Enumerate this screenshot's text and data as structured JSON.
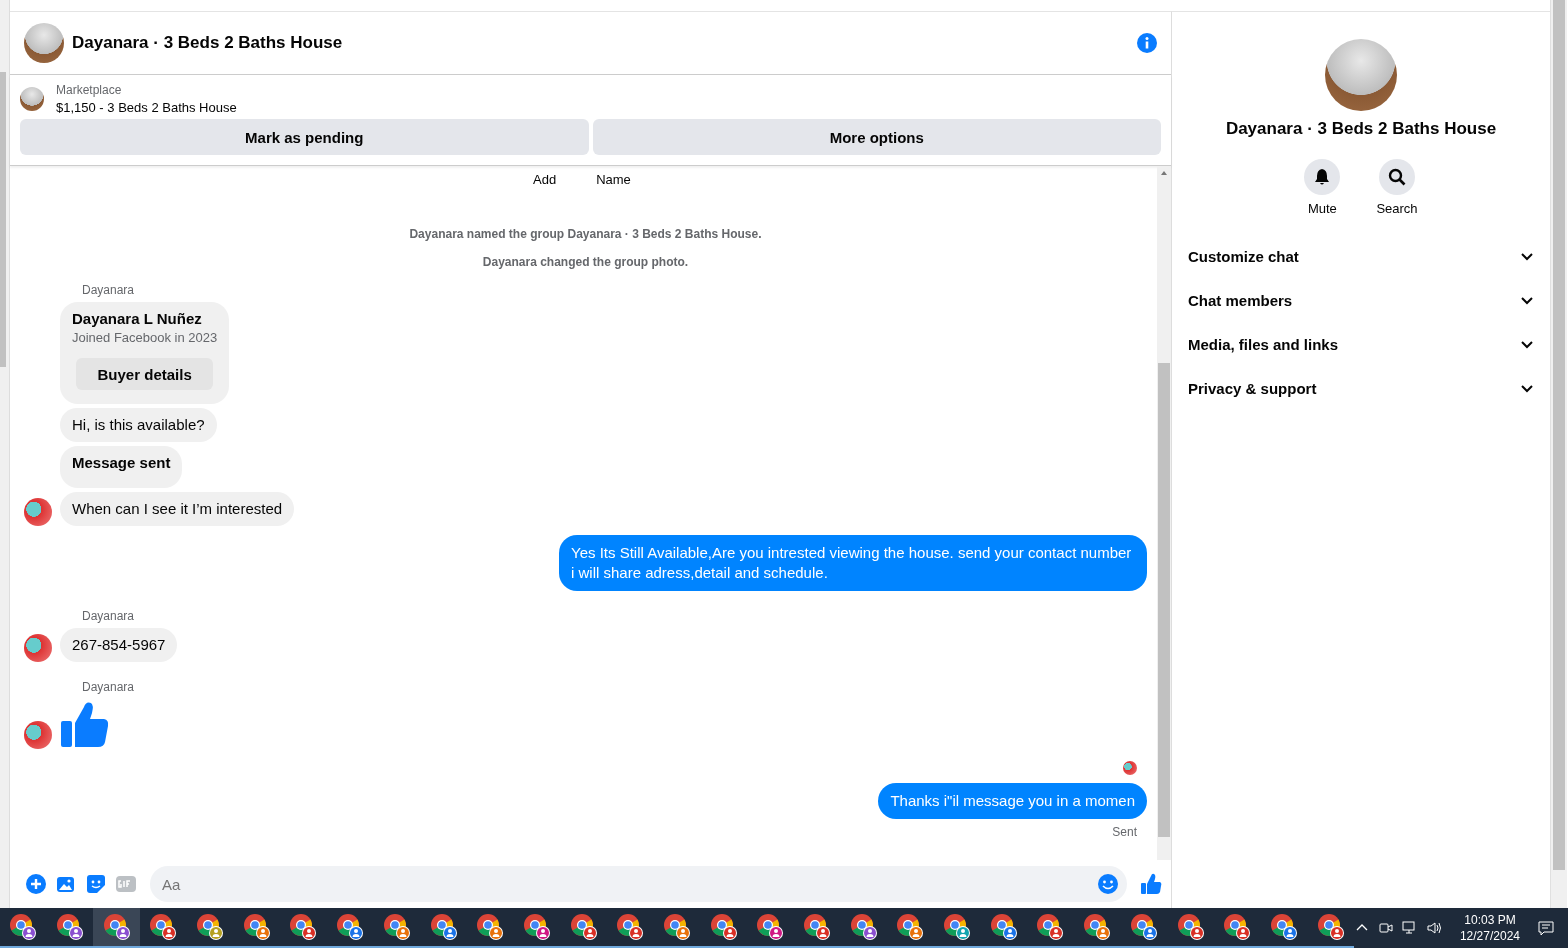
{
  "chat": {
    "title": "Dayanara · 3 Beds 2 Baths House",
    "listing": {
      "source": "Marketplace",
      "title": "$1,150 - 3 Beds 2 Baths House"
    },
    "actions": [
      "Mark as pending",
      "More options"
    ],
    "clipped_row": [
      "Add",
      "Name"
    ],
    "messages": [
      {
        "kind": "system",
        "text": "Dayanara named the group Dayanara · 3 Beds 2 Baths House."
      },
      {
        "kind": "system",
        "text": "Dayanara changed the group photo."
      },
      {
        "kind": "sender",
        "text": "Dayanara"
      },
      {
        "kind": "card",
        "name": "Dayanara L Nuñez",
        "subtitle": "Joined Facebook in 2023",
        "button": "Buyer details"
      },
      {
        "kind": "incoming",
        "text": "Hi, is this available?",
        "avatar": false
      },
      {
        "kind": "notice",
        "text": "Message sent",
        "avatar": false
      },
      {
        "kind": "incoming",
        "text": "When can I see it I’m interested",
        "avatar": true
      },
      {
        "kind": "outgoing",
        "text": "Yes Its Still Available,Are you intrested viewing the house. send your contact number i will share adress,detail and schedule."
      },
      {
        "kind": "sender",
        "text": "Dayanara"
      },
      {
        "kind": "incoming",
        "text": "267-854-5967",
        "avatar": true
      },
      {
        "kind": "sender",
        "text": "Dayanara"
      },
      {
        "kind": "like",
        "avatar": true
      },
      {
        "kind": "seen"
      },
      {
        "kind": "outgoing",
        "text": "Thanks i\"il message you in a momen"
      },
      {
        "kind": "status",
        "text": "Sent"
      }
    ],
    "composer": {
      "placeholder": "Aa"
    }
  },
  "details": {
    "title": "Dayanara · 3 Beds 2 Baths House",
    "buttons": [
      {
        "kind": "mute",
        "label": "Mute"
      },
      {
        "kind": "search",
        "label": "Search"
      }
    ],
    "sections": [
      {
        "label": "Customize chat",
        "expanded": false
      },
      {
        "label": "Chat members",
        "expanded": false
      },
      {
        "label": "Media, files and links",
        "expanded": false
      },
      {
        "label": "Privacy & support",
        "expanded": false
      }
    ]
  },
  "taskbar": {
    "apps": [
      {
        "color": "#8a4fd0",
        "selected": false
      },
      {
        "color": "#8a4fd0",
        "selected": false
      },
      {
        "color": "#8a4fd0",
        "selected": true
      },
      {
        "color": "#d93025",
        "selected": false
      },
      {
        "color": "#b5a020",
        "selected": false
      },
      {
        "color": "#e8710a",
        "selected": false
      },
      {
        "color": "#d93025",
        "selected": false
      },
      {
        "color": "#1a73e8",
        "selected": false
      },
      {
        "color": "#e8710a",
        "selected": false
      },
      {
        "color": "#1a73e8",
        "selected": false
      },
      {
        "color": "#e8710a",
        "selected": false
      },
      {
        "color": "#d01884",
        "selected": false
      },
      {
        "color": "#d93025",
        "selected": false
      },
      {
        "color": "#d93025",
        "selected": false
      },
      {
        "color": "#e8710a",
        "selected": false
      },
      {
        "color": "#d93025",
        "selected": false
      },
      {
        "color": "#d01884",
        "selected": false
      },
      {
        "color": "#d93025",
        "selected": false
      },
      {
        "color": "#8a4fd0",
        "selected": false
      },
      {
        "color": "#e8710a",
        "selected": false
      },
      {
        "color": "#12a4af",
        "selected": false
      },
      {
        "color": "#1a73e8",
        "selected": false
      },
      {
        "color": "#d93025",
        "selected": false
      },
      {
        "color": "#e8710a",
        "selected": false
      },
      {
        "color": "#1a73e8",
        "selected": false
      },
      {
        "color": "#d93025",
        "selected": false
      },
      {
        "color": "#d93025",
        "selected": false
      },
      {
        "color": "#1a73e8",
        "selected": false
      },
      {
        "color": "#d93025",
        "selected": false
      }
    ],
    "time": "10:03 PM",
    "date": "12/27/2024"
  }
}
